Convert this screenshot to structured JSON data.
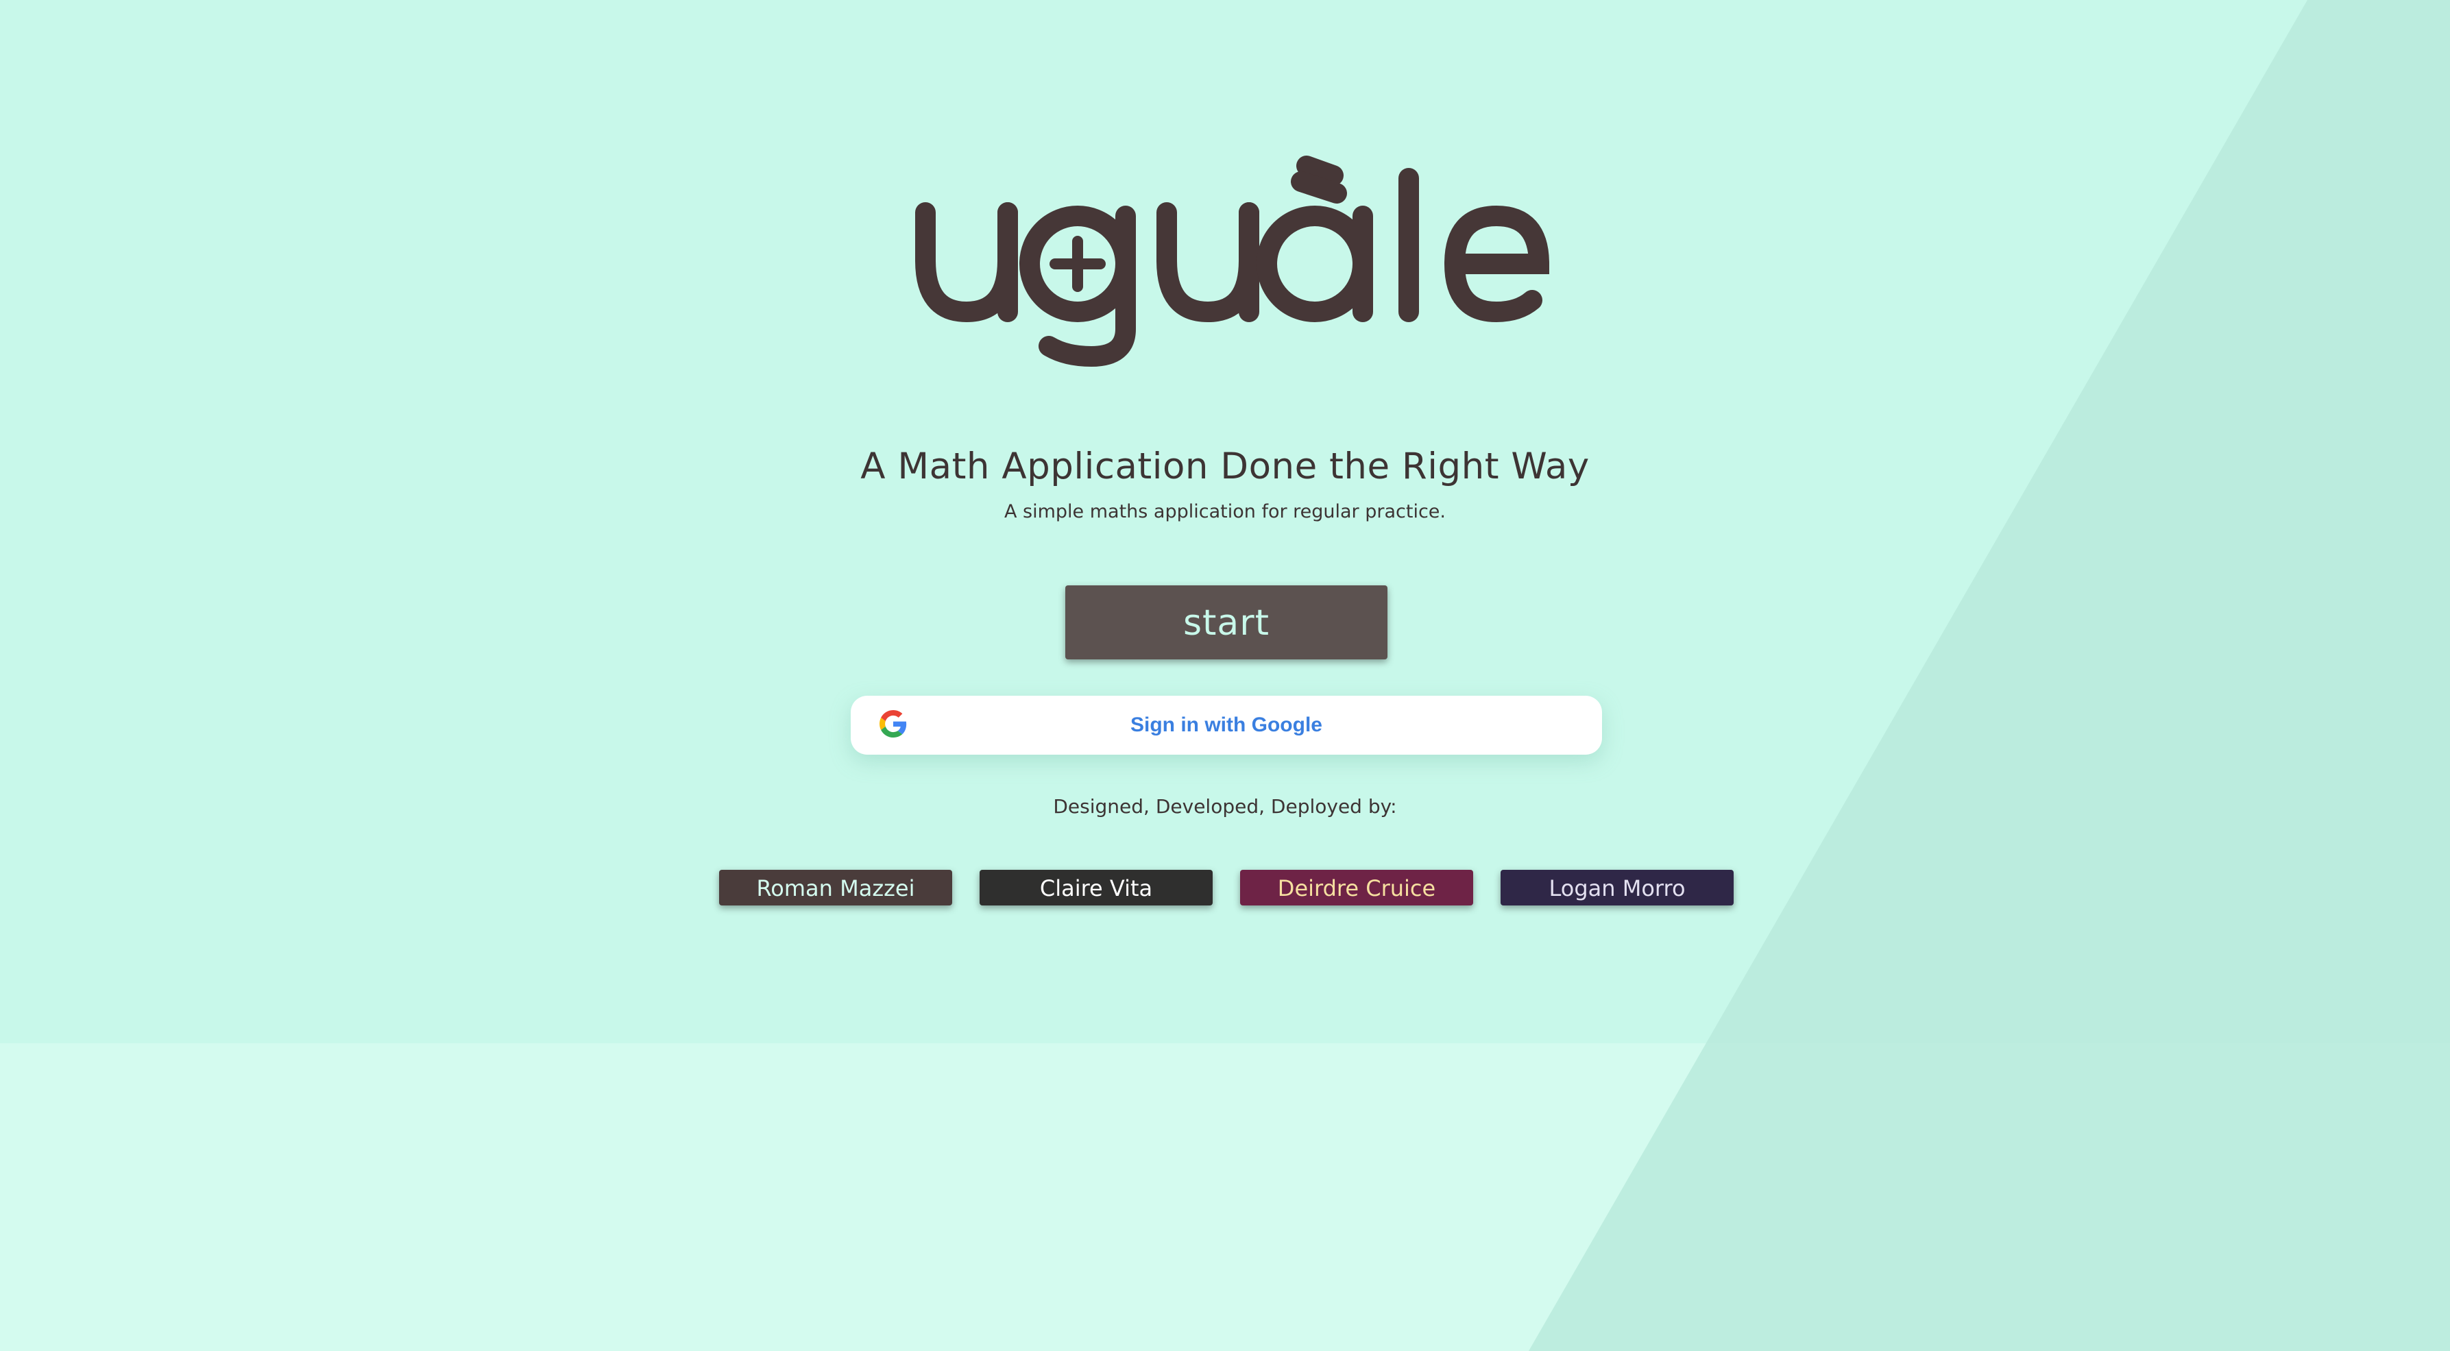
{
  "app": {
    "name": "uguale",
    "headline": "A Math Application Done the Right Way",
    "subheadline": "A simple maths application for regular practice."
  },
  "colors": {
    "background_upper": "#c8f8ea",
    "background_lower": "#d4fbef",
    "diagonal_shade": "#b8eadc",
    "text_dark": "#3d3434",
    "start_button": "#5c5250",
    "google_text": "#3a7fe0"
  },
  "actions": {
    "start_label": "start",
    "google_signin_label": "Sign in with Google"
  },
  "credits": {
    "label": "Designed, Developed, Deployed by:",
    "developers": [
      {
        "name": "Roman Mazzei",
        "bg": "#4a3c3b",
        "fg": "#d4fbef"
      },
      {
        "name": "Claire Vita",
        "bg": "#2f2f2e",
        "fg": "#ffffff"
      },
      {
        "name": "Deirdre Cruice",
        "bg": "#6e2346",
        "fg": "#f6e0a0"
      },
      {
        "name": "Logan Morro",
        "bg": "#2f2747",
        "fg": "#e3e0f0"
      }
    ]
  }
}
